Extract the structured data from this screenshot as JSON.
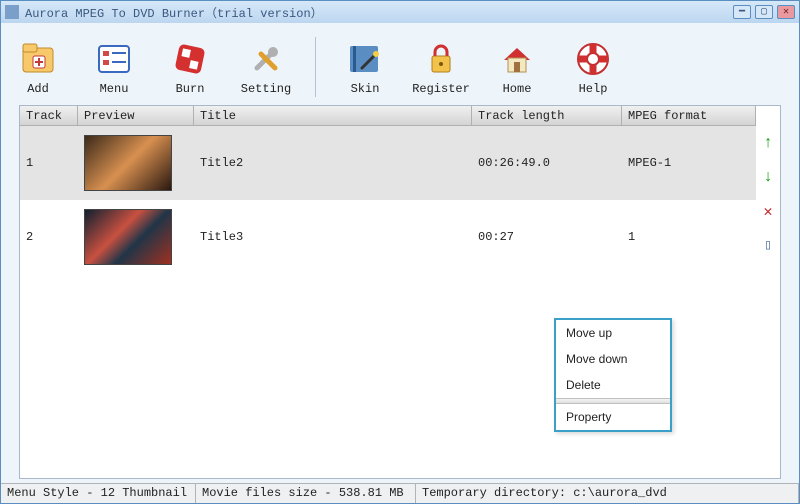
{
  "window": {
    "title": "Aurora MPEG To DVD Burner（trial version）"
  },
  "toolbar": {
    "add": "Add",
    "menu": "Menu",
    "burn": "Burn",
    "setting": "Setting",
    "skin": "Skin",
    "register": "Register",
    "home": "Home",
    "help": "Help"
  },
  "columns": {
    "track": "Track",
    "preview": "Preview",
    "title": "Title",
    "length": "Track length",
    "format": "MPEG format"
  },
  "rows": [
    {
      "track": "1",
      "title": "Title2",
      "length": "00:26:49.0",
      "format": "MPEG-1"
    },
    {
      "track": "2",
      "title": "Title3",
      "length": "00:27",
      "format": "1"
    }
  ],
  "context_menu": {
    "move_up": "Move up",
    "move_down": "Move down",
    "delete": "Delete",
    "property": "Property"
  },
  "status": {
    "menu_style": "Menu Style - 12 Thumbnail",
    "files_size": "Movie files size - 538.81 MB",
    "temp_dir": "Temporary directory: c:\\aurora_dvd"
  },
  "icons": {
    "up": "↑",
    "down": "↓",
    "delete": "✕",
    "clip": "▯"
  }
}
